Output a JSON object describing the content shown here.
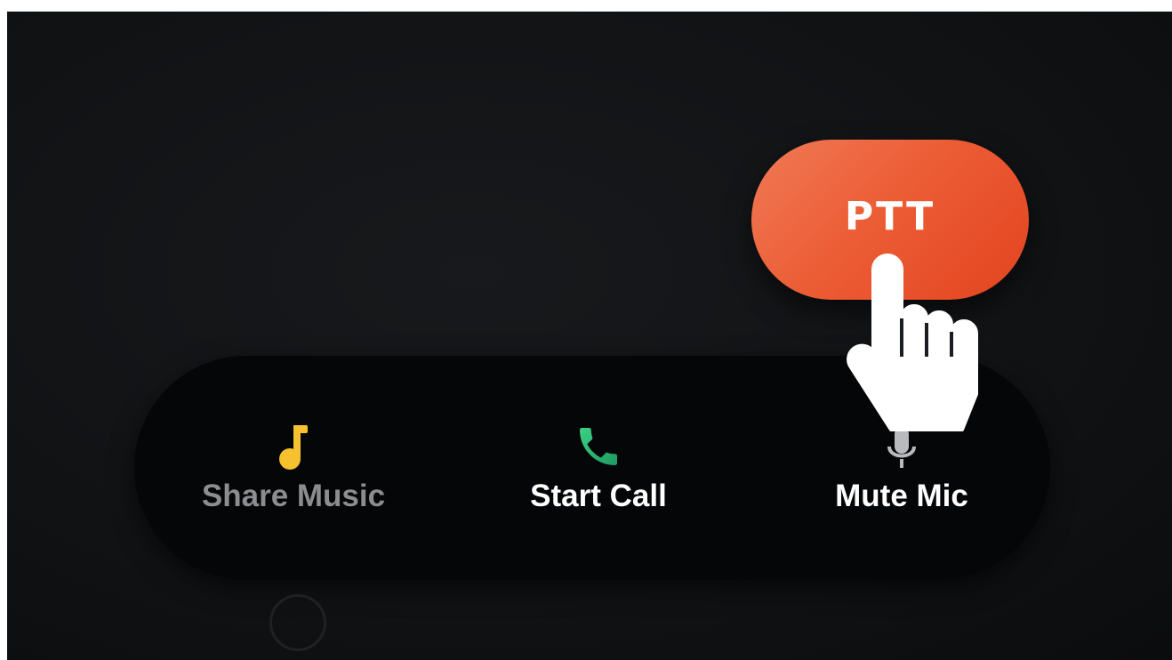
{
  "ptt": {
    "label": "PTT",
    "color": "#EC5D36"
  },
  "actions": [
    {
      "label": "Share Music",
      "icon": "music-note-icon",
      "icon_color": "#F5C12E",
      "state": "disabled"
    },
    {
      "label": "Start Call",
      "icon": "phone-icon",
      "icon_color": "#2DB572",
      "state": "enabled"
    },
    {
      "label": "Mute Mic",
      "icon": "microphone-icon",
      "icon_color": "#B8BABD",
      "state": "enabled"
    }
  ],
  "pointer": {
    "icon": "hand-pointer-icon"
  },
  "colors": {
    "background": "#101214",
    "action_bar": "#050607",
    "label_active": "#FFFFFF",
    "label_disabled": "#8B8D90"
  }
}
